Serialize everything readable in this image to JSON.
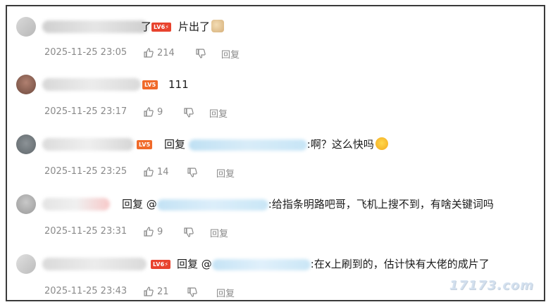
{
  "comments": [
    {
      "badge": "LV6",
      "badge_icon": "lightning-icon",
      "pre_text": "了",
      "text": "片出了",
      "emoji": "doge-emoji",
      "time": "2025-11-25 23:05",
      "likes": "214",
      "reply_label": "回复"
    },
    {
      "badge": "LV5",
      "text": "111",
      "time": "2025-11-25 23:17",
      "likes": "9",
      "reply_label": "回复"
    },
    {
      "badge": "LV5",
      "reply_prefix": "回复",
      "text": ":啊？这么快吗",
      "emoji": "shocked-emoji",
      "time": "2025-11-25 23:25",
      "likes": "14",
      "reply_label": "回复"
    },
    {
      "reply_prefix": "回复 @",
      "text": ":给指条明路吧哥，飞机上搜不到，有啥关键词吗",
      "time": "2025-11-25 23:31",
      "likes": "9",
      "reply_label": "回复"
    },
    {
      "badge": "LV6",
      "badge_icon": "lightning-icon",
      "reply_prefix": "回复 @",
      "text": ":在x上刷到的，估计快有大佬的成片了",
      "time": "2025-11-25 23:43",
      "likes": "21",
      "reply_label": "回复"
    }
  ],
  "watermark": "17173.com",
  "colors": {
    "badge_lv6": "#e8432e",
    "badge_lv5": "#f06a2a",
    "meta_gray": "#8a8a8a"
  }
}
